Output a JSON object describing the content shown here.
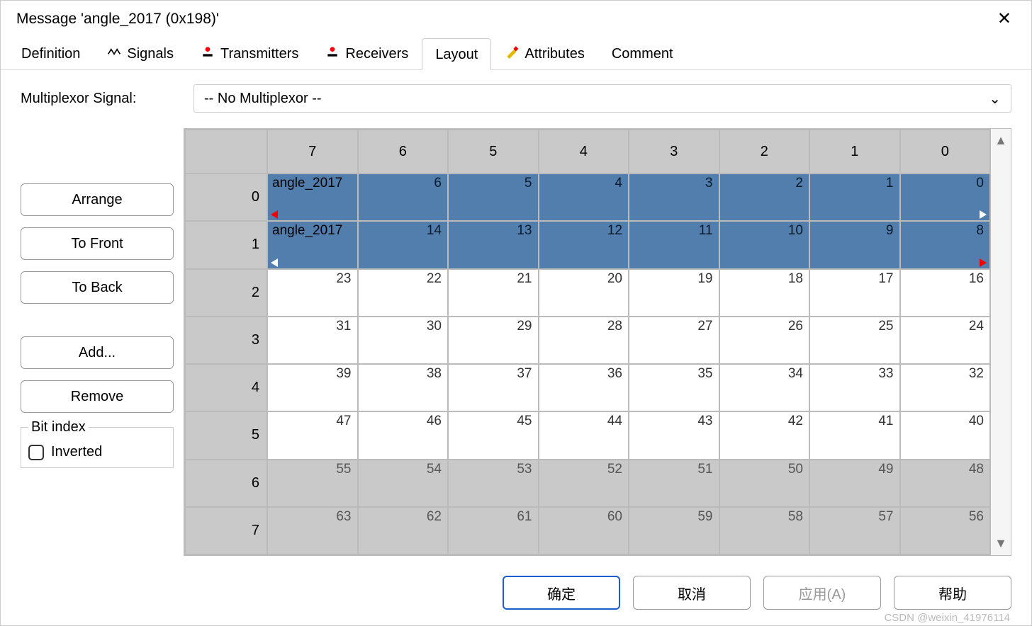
{
  "title": "Message 'angle_2017 (0x198)'",
  "close_tooltip": "Close",
  "tabs": {
    "definition": "Definition",
    "signals": "Signals",
    "transmitters": "Transmitters",
    "receivers": "Receivers",
    "layout": "Layout",
    "attributes": "Attributes",
    "comment": "Comment"
  },
  "active_tab": "layout",
  "mux": {
    "label": "Multiplexor Signal:",
    "value": "-- No Multiplexor --"
  },
  "side_buttons": {
    "arrange": "Arrange",
    "to_front": "To Front",
    "to_back": "To Back",
    "add": "Add...",
    "remove": "Remove"
  },
  "bit_index": {
    "legend": "Bit index",
    "inverted_label": "Inverted",
    "inverted_checked": false
  },
  "grid": {
    "col_headers": [
      "7",
      "6",
      "5",
      "4",
      "3",
      "2",
      "1",
      "0"
    ],
    "row_headers": [
      "0",
      "1",
      "2",
      "3",
      "4",
      "5",
      "6",
      "7"
    ],
    "signal_name": "angle_2017",
    "rows": [
      {
        "type": "signal",
        "label": "angle_2017",
        "cells": [
          "",
          "6",
          "5",
          "4",
          "3",
          "2",
          "1",
          "0"
        ],
        "marker": {
          "left": "red",
          "right": "white"
        }
      },
      {
        "type": "signal",
        "label": "angle_2017",
        "cells": [
          "",
          "14",
          "13",
          "12",
          "11",
          "10",
          "9",
          "8"
        ],
        "marker": {
          "left": "white",
          "right": "red"
        }
      },
      {
        "type": "plain",
        "cells": [
          "23",
          "22",
          "21",
          "20",
          "19",
          "18",
          "17",
          "16"
        ]
      },
      {
        "type": "plain",
        "cells": [
          "31",
          "30",
          "29",
          "28",
          "27",
          "26",
          "25",
          "24"
        ]
      },
      {
        "type": "plain",
        "cells": [
          "39",
          "38",
          "37",
          "36",
          "35",
          "34",
          "33",
          "32"
        ]
      },
      {
        "type": "plain",
        "cells": [
          "47",
          "46",
          "45",
          "44",
          "43",
          "42",
          "41",
          "40"
        ]
      },
      {
        "type": "grey",
        "cells": [
          "55",
          "54",
          "53",
          "52",
          "51",
          "50",
          "49",
          "48"
        ]
      },
      {
        "type": "grey",
        "cells": [
          "63",
          "62",
          "61",
          "60",
          "59",
          "58",
          "57",
          "56"
        ]
      }
    ]
  },
  "footer": {
    "ok": "确定",
    "cancel": "取消",
    "apply": "应用(A)",
    "help": "帮助"
  },
  "watermark": "CSDN @weixin_41976114"
}
